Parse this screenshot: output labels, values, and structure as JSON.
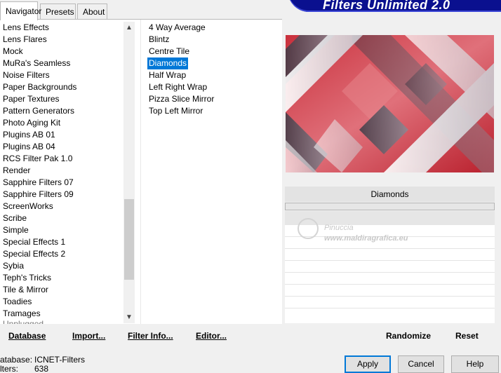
{
  "tabs": [
    "Navigator",
    "Presets",
    "About"
  ],
  "banner_title": "Filters Unlimited 2.0",
  "categories": [
    "Lens Effects",
    "Lens Flares",
    "Mock",
    "MuRa's Seamless",
    "Noise Filters",
    "Paper Backgrounds",
    "Paper Textures",
    "Pattern Generators",
    "Photo Aging Kit",
    "Plugins AB 01",
    "Plugins AB 04",
    "RCS Filter Pak 1.0",
    "Render",
    "Sapphire Filters 07",
    "Sapphire Filters 09",
    "ScreenWorks",
    "Scribe",
    "Simple",
    "Special Effects 1",
    "Special Effects 2",
    "Sybia",
    "Teph's Tricks",
    "Tile & Mirror",
    "Toadies",
    "Tramages"
  ],
  "filters": [
    "4 Way Average",
    "Blintz",
    "Centre Tile",
    "Diamonds",
    "Half Wrap",
    "Left Right Wrap",
    "Pizza Slice Mirror",
    "Top Left Mirror"
  ],
  "selected_filter_index": 3,
  "bottom_buttons": {
    "database": "Database",
    "import": "Import...",
    "filter_info": "Filter Info...",
    "editor": "Editor..."
  },
  "preview_filter_name": "Diamonds",
  "watermark": {
    "name": "Pinuccia",
    "url": "www.maldiragrafica.eu"
  },
  "right_buttons": {
    "randomize": "Randomize",
    "reset": "Reset"
  },
  "status": {
    "database_label": "atabase:",
    "database_value": "ICNET-Filters",
    "filters_label": "lters:",
    "filters_value": "638"
  },
  "dialog_buttons": {
    "apply": "Apply",
    "cancel": "Cancel",
    "help": "Help"
  },
  "colors": {
    "selection": "#0078d7",
    "banner": "#0a108f",
    "preview_red": "#d1333f",
    "preview_dark": "#4d4a57"
  }
}
